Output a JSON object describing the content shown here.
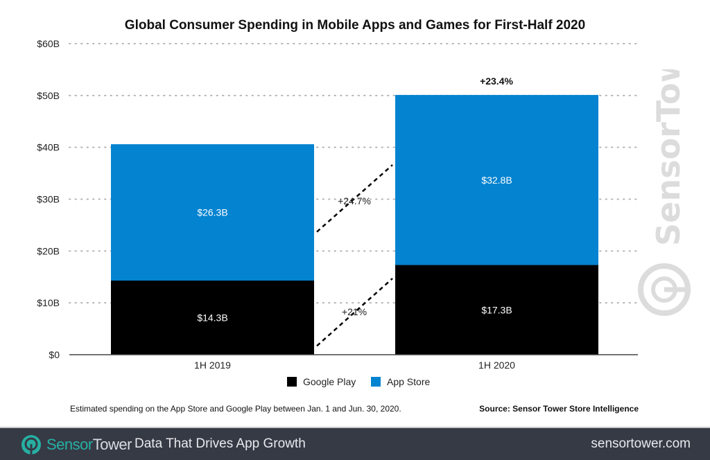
{
  "chart_data": {
    "type": "bar",
    "stacked": true,
    "title": "Global Consumer Spending in Mobile Apps and Games for First-Half 2020",
    "categories": [
      "1H 2019",
      "1H 2020"
    ],
    "series": [
      {
        "name": "Google Play",
        "color": "#000000",
        "values": [
          14.3,
          17.3
        ],
        "labels": [
          "$14.3B",
          "$17.3B"
        ]
      },
      {
        "name": "App Store",
        "color": "#0483d0",
        "values": [
          26.3,
          32.8
        ],
        "labels": [
          "$26.3B",
          "$32.8B"
        ]
      }
    ],
    "ylim": [
      0,
      60
    ],
    "yticks": [
      0,
      10,
      20,
      30,
      40,
      50,
      60
    ],
    "ytick_labels": [
      "$0",
      "$10B",
      "$20B",
      "$30B",
      "$40B",
      "$50B",
      "$60B"
    ],
    "xlabel": "",
    "ylabel": "",
    "grid": true,
    "legend": {
      "placement": "bottom",
      "entries": [
        "Google Play",
        "App Store"
      ]
    },
    "annotations": {
      "total_growth": "+23.4%",
      "app_store_growth": "+24.7%",
      "google_play_growth": "+21%"
    }
  },
  "note": "Estimated spending on the App Store and Google Play between Jan. 1 and Jun. 30, 2020.",
  "source": "Source: Sensor Tower Store Intelligence",
  "watermark": "SensorTower",
  "footer": {
    "brand_part1": "Sensor",
    "brand_part2": "Tower",
    "tagline": "Data That Drives App Growth",
    "site": "sensortower.com"
  }
}
